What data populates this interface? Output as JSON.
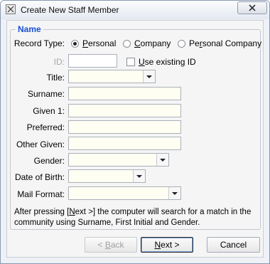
{
  "window": {
    "title": "Create New Staff Member"
  },
  "group": {
    "title": "Name"
  },
  "record_type": {
    "label": "Record Type:",
    "options": [
      {
        "pre": "",
        "ul": "P",
        "post": "ersonal",
        "selected": true
      },
      {
        "pre": "",
        "ul": "C",
        "post": "ompany",
        "selected": false
      },
      {
        "pre": "Pe",
        "ul": "r",
        "post": "sonal Company",
        "selected": false
      }
    ]
  },
  "id_field": {
    "label": "ID:",
    "value": ""
  },
  "use_existing": {
    "ul": "U",
    "post": "se existing ID",
    "checked": false
  },
  "fields": {
    "title": {
      "label": "Title:",
      "value": ""
    },
    "surname": {
      "label": "Surname:",
      "value": ""
    },
    "given1": {
      "label": "Given 1:",
      "value": ""
    },
    "preferred": {
      "label": "Preferred:",
      "value": ""
    },
    "other_given": {
      "label": "Other Given:",
      "value": ""
    },
    "gender": {
      "label": "Gender:",
      "value": ""
    },
    "dob": {
      "label": "Date of Birth:",
      "value": ""
    },
    "mail_format": {
      "label": "Mail Format:",
      "value": ""
    }
  },
  "info": {
    "pre": "After pressing [",
    "ul": "N",
    "post": "ext >] the computer will search for a match in the community using Surname, First Initial and Gender."
  },
  "buttons": {
    "back": {
      "pre": "< ",
      "ul": "B",
      "post": "ack"
    },
    "next": {
      "ul": "N",
      "post": "ext >"
    },
    "cancel": {
      "label": "Cancel"
    }
  }
}
